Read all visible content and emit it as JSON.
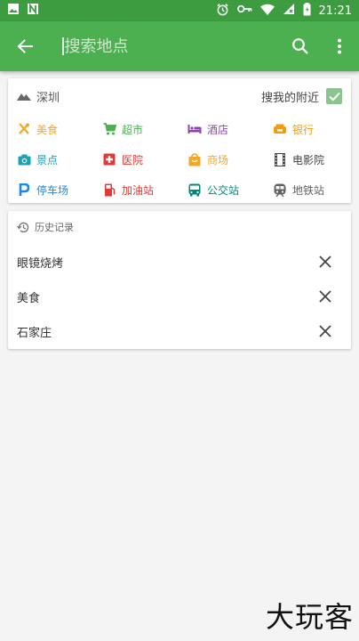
{
  "status_bar": {
    "time": "21:21",
    "bg_color": "#3d9c40"
  },
  "app_bar": {
    "bg_color": "#4caf50",
    "back_icon": "arrow-back-icon",
    "search_placeholder": "搜索地点",
    "search_icon": "search-icon",
    "more_icon": "more-vert-icon"
  },
  "location": {
    "city": "深圳",
    "nearby_label": "搜我的附近",
    "nearby_checked": true
  },
  "categories": [
    {
      "label": "美食",
      "icon": "utensils-icon",
      "color": "#f5a623"
    },
    {
      "label": "超市",
      "icon": "cart-icon",
      "color": "#4caf50"
    },
    {
      "label": "酒店",
      "icon": "bed-icon",
      "color": "#8e44ad"
    },
    {
      "label": "银行",
      "icon": "bank-icon",
      "color": "#f39c12"
    },
    {
      "label": "景点",
      "icon": "camera-icon",
      "color": "#17a2b8"
    },
    {
      "label": "医院",
      "icon": "hospital-icon",
      "color": "#e53935"
    },
    {
      "label": "商场",
      "icon": "shopping-bag-icon",
      "color": "#f5a623"
    },
    {
      "label": "电影院",
      "icon": "film-icon",
      "color": "#424242"
    },
    {
      "label": "停车场",
      "icon": "parking-icon",
      "color": "#1e88e5"
    },
    {
      "label": "加油站",
      "icon": "gas-station-icon",
      "color": "#e53935"
    },
    {
      "label": "公交站",
      "icon": "bus-icon",
      "color": "#00897b"
    },
    {
      "label": "地铁站",
      "icon": "subway-icon",
      "color": "#616161"
    }
  ],
  "history": {
    "title": "历史记录",
    "items": [
      {
        "label": "眼镜烧烤"
      },
      {
        "label": "美食"
      },
      {
        "label": "石家庄"
      }
    ]
  },
  "watermark": "大玩客"
}
